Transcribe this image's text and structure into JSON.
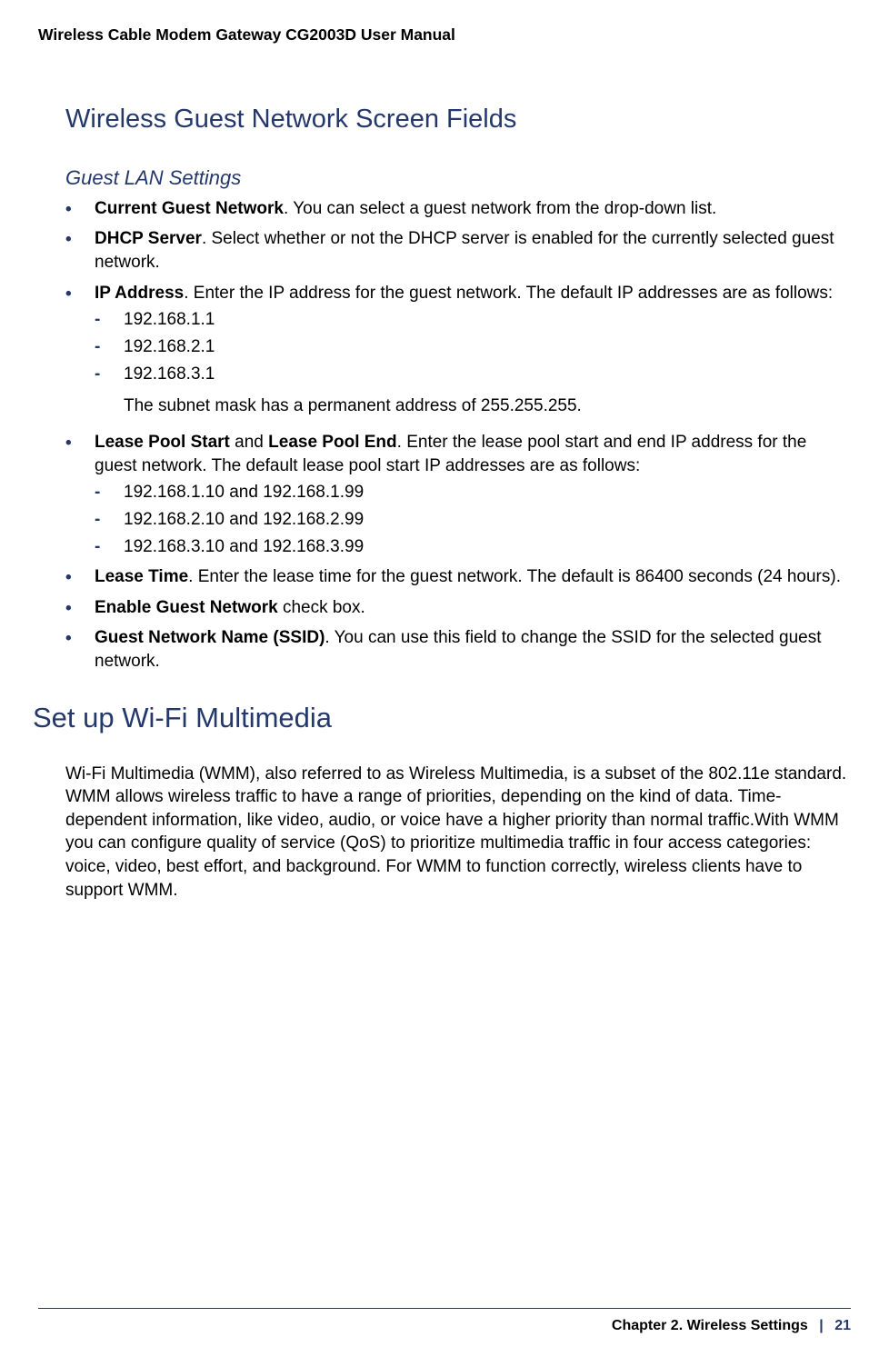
{
  "header": {
    "running_title": "Wireless Cable Modem Gateway CG2003D User Manual"
  },
  "section": {
    "title": "Wireless Guest Network Screen Fields",
    "subsection_title": "Guest LAN Settings",
    "bullets": [
      {
        "label": "Current Guest Network",
        "text": ". You can select a guest network from the drop-down list."
      },
      {
        "label": "DHCP Server",
        "text": ". Select whether or not the DHCP server is enabled for the currently selected guest network."
      },
      {
        "label": "IP Address",
        "text": ". Enter the IP address for the guest network. The default IP addresses are as follows:",
        "sub": [
          "192.168.1.1",
          "192.168.2.1",
          "192.168.3.1"
        ],
        "after_para": "The subnet mask has a permanent address of 255.255.255."
      },
      {
        "label_parts": [
          "Lease Pool Start",
          " and ",
          "Lease Pool End"
        ],
        "text": ". Enter the lease pool start and end IP address for the guest network. The default lease pool start IP addresses are as follows:",
        "sub": [
          "192.168.1.10 and 192.168.1.99",
          "192.168.2.10 and 192.168.2.99",
          "192.168.3.10 and 192.168.3.99"
        ]
      },
      {
        "label": "Lease Time",
        "text": ". Enter the lease time for the guest network. The default is 86400 seconds (24 hours)."
      },
      {
        "label": "Enable Guest Network",
        "text": " check box."
      },
      {
        "label": "Guest Network Name (SSID)",
        "text": ". You can use this field to change the SSID for the selected guest network."
      }
    ]
  },
  "section2": {
    "title": "Set up Wi-Fi Multimedia",
    "para": "Wi-Fi Multimedia (WMM), also referred to as Wireless Multimedia, is a subset of the 802.11e standard. WMM allows wireless traffic to have a range of priorities, depending on the kind of data. Time-dependent information, like video, audio, or voice have a higher priority than normal traffic.With WMM you can configure quality of service (QoS) to prioritize multimedia traffic in four access categories: voice, video, best effort, and background. For WMM to function correctly, wireless clients have to support WMM."
  },
  "footer": {
    "chapter": "Chapter 2.  Wireless Settings",
    "separator": "|",
    "page": "21"
  }
}
